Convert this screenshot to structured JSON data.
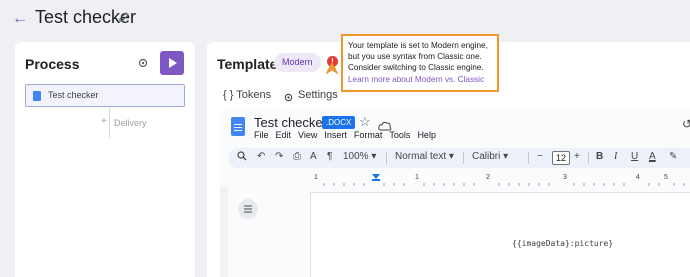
{
  "header": {
    "back_icon": "arrow-left-icon",
    "title": "Test checker",
    "edit_icon": "pencil-icon"
  },
  "process": {
    "title": "Process",
    "step_label": "Test checker",
    "delivery_label": "Delivery"
  },
  "template": {
    "title": "Template",
    "engine_badge": "Modern",
    "warning_icon": "!",
    "tabs": [
      {
        "icon": "{ }",
        "label": "Tokens"
      },
      {
        "icon": "gear-icon",
        "label": "Settings"
      }
    ]
  },
  "tooltip": {
    "lines": [
      "Your template is set to Modern engine,",
      "but you use syntax from Classic one.",
      "Consider switching to Classic engine."
    ],
    "link": "Learn more about Modern vs. Classic",
    "border_color": "#f0962a"
  },
  "doc": {
    "title": "Test checker",
    "badge": ".DOCX",
    "menu": [
      "File",
      "Edit",
      "View",
      "Insert",
      "Format",
      "Tools",
      "Help"
    ],
    "toolbar": {
      "zoom": "100%",
      "style": "Normal text",
      "font": "Calibri",
      "font_size": "12"
    },
    "ruler_numbers": [
      "1",
      "1",
      "2",
      "3",
      "4",
      "5"
    ],
    "body_text": "{{imageData}:picture}"
  },
  "colors": {
    "accent": "#7e57c2",
    "docs_blue": "#4285f4"
  }
}
